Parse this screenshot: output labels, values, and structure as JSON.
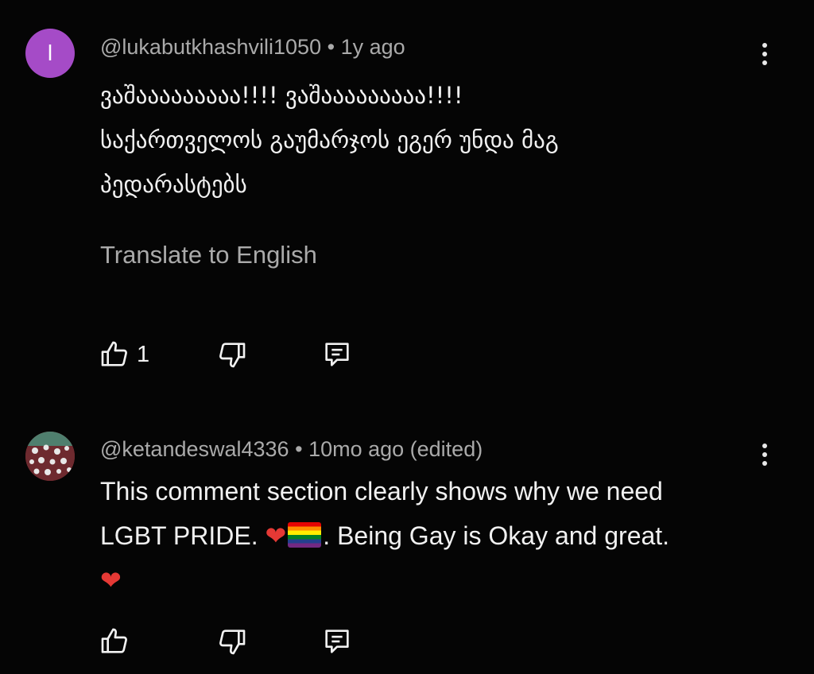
{
  "comments": [
    {
      "avatar_letter": "l",
      "avatar_color": "#a54bc7",
      "handle": "@lukabutkhashvili1050",
      "separator": "•",
      "time": "1y ago",
      "lines": [
        "ვაშააააააააა!!!! ვაშააააააააა!!!!",
        "საქართველოს გაუმარჯოს ეგერ უნდა მაგ",
        "პედარასტებს"
      ],
      "translate_label": "Translate to English",
      "like_count": "1",
      "icons": [
        "thumbs-up-icon",
        "thumbs-down-icon",
        "reply-icon",
        "more-vert-icon"
      ]
    },
    {
      "handle": "@ketandeswal4336",
      "separator": "•",
      "time": "10mo ago (edited)",
      "line1": "This comment section clearly shows why we need",
      "line2_text": "LGBT PRIDE.",
      "heart": "❤",
      "line2_rest": ". Being Gay is Okay and great.",
      "line3_heart": "❤",
      "icons": [
        "thumbs-up-icon",
        "thumbs-down-icon",
        "reply-icon",
        "more-vert-icon",
        "rainbow-flag-icon"
      ]
    }
  ]
}
